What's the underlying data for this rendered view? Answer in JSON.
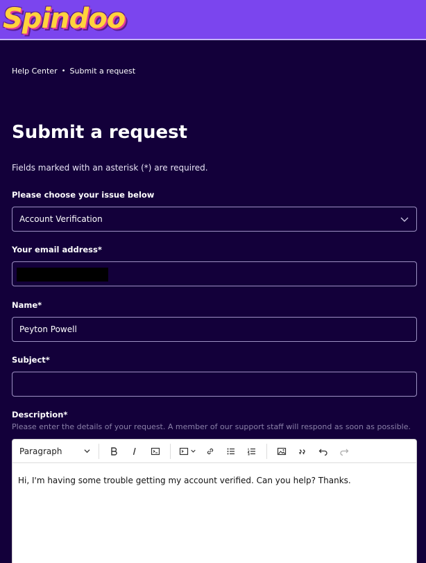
{
  "header": {
    "logo_text": "Spindoo"
  },
  "breadcrumb": {
    "items": [
      "Help Center",
      "Submit a request"
    ],
    "separator": "•"
  },
  "page": {
    "title": "Submit a request",
    "required_note": "Fields marked with an asterisk (*) are required."
  },
  "form": {
    "issue": {
      "label": "Please choose your issue below",
      "value": "Account Verification"
    },
    "email": {
      "label": "Your email address*",
      "value": ""
    },
    "name": {
      "label": "Name*",
      "value": "Peyton Powell"
    },
    "subject": {
      "label": "Subject*",
      "value": ""
    },
    "description": {
      "label": "Description*",
      "hint": "Please enter the details of your request. A member of our support staff will respond as soon as possible.",
      "format_select": "Paragraph",
      "body": "Hi, I'm having some trouble getting my account verified. Can you help? Thanks."
    }
  },
  "colors": {
    "background": "#13003a",
    "header": "#7b45ee",
    "logo": "#ffd23d",
    "field_border": "#9e92c4"
  }
}
